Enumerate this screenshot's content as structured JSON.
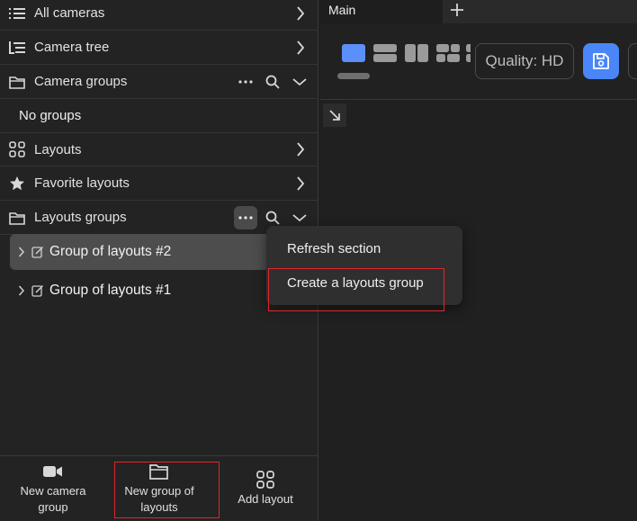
{
  "sidebar": {
    "sections": [
      {
        "label": "All cameras",
        "icon": "list-icon"
      },
      {
        "label": "Camera tree",
        "icon": "tree-icon"
      },
      {
        "label": "Camera groups",
        "icon": "folder-icon"
      },
      {
        "label": "Layouts",
        "icon": "grid-icon"
      },
      {
        "label": "Favorite layouts",
        "icon": "star-icon"
      },
      {
        "label": "Layouts groups",
        "icon": "folder-icon"
      }
    ],
    "no_groups": "No groups",
    "layout_groups": [
      {
        "label": "Group of layouts #2",
        "selected": true
      },
      {
        "label": "Group of layouts #1",
        "selected": false
      }
    ],
    "bottom": {
      "new_camera_group": "New camera group",
      "new_group_of_layouts": "New group of layouts",
      "add_layout": "Add layout"
    }
  },
  "main": {
    "tab_label": "Main",
    "quality_label": "Quality: HD"
  },
  "context_menu": {
    "refresh": "Refresh section",
    "create": "Create a layouts group"
  },
  "colors": {
    "accent": "#4a86f7",
    "highlight": "#e0262c"
  }
}
